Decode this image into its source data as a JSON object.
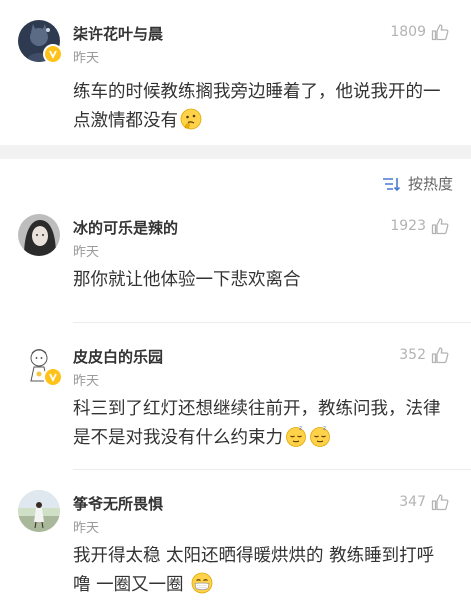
{
  "post": {
    "author": "柒许花叶与晨",
    "time": "昨天",
    "likes": "1809",
    "text": "练车的时候教练搁我旁边睡着了，他说我开的一点激情都没有",
    "emoji": "thinking-face"
  },
  "sort": {
    "label": "按热度"
  },
  "comments": [
    {
      "author": "冰的可乐是辣的",
      "time": "昨天",
      "likes": "1923",
      "text": "那你就让他体验一下悲欢离合",
      "emojis": []
    },
    {
      "author": "皮皮白的乐园",
      "time": "昨天",
      "likes": "352",
      "verified": true,
      "text": "科三到了红灯还想继续往前开，教练问我，法律是不是对我没有什么约束力",
      "emojis": [
        "sleepy-face",
        "sleepy-face"
      ]
    },
    {
      "author": "筝爷无所畏惧",
      "time": "昨天",
      "likes": "347",
      "text": "我开得太稳 太阳还晒得暖烘烘的 教练睡到打呼噜 一圈又一圈",
      "emojis": [
        "mask-face"
      ]
    }
  ],
  "colors": {
    "badge": "#ffc21a",
    "muted": "#9a9a9a",
    "text": "#333333"
  }
}
